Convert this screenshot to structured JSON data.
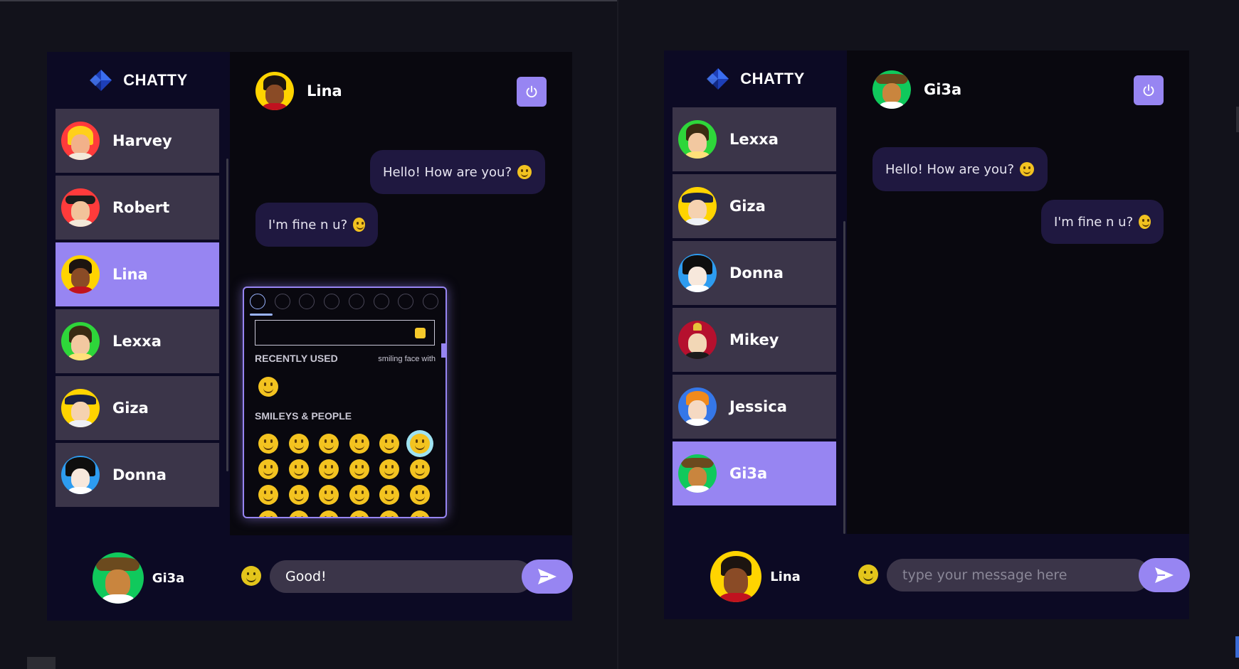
{
  "left": {
    "app_name": "CHATTY",
    "contacts": [
      {
        "name": "Harvey",
        "avatar": "harvey-avatar"
      },
      {
        "name": "Robert",
        "avatar": "robert-avatar"
      },
      {
        "name": "Lina",
        "avatar": "lina-avatar",
        "active": true
      },
      {
        "name": "Lexxa",
        "avatar": "lexxa-avatar"
      },
      {
        "name": "Giza",
        "avatar": "giza-avatar"
      },
      {
        "name": "Donna",
        "avatar": "donna-avatar"
      }
    ],
    "current_user": {
      "name": "Gi3a"
    },
    "chat": {
      "partner": "Lina",
      "messages": [
        {
          "text": "Hello! How are you?",
          "emoji": "smiley"
        },
        {
          "text": "I'm fine n u?",
          "emoji": "wink"
        }
      ],
      "input_value": "Good!",
      "input_placeholder": "type your message here"
    },
    "emoji_picker": {
      "recently_used_label": "RECENTLY USED",
      "hint": "smiling face with",
      "smileys_label": "SMILEYS & PEOPLE",
      "category_icons": [
        "people-icon",
        "face-icon",
        "animal-icon",
        "food-icon",
        "ball-icon",
        "clock-icon",
        "heart-icon",
        "globe-icon"
      ]
    }
  },
  "right": {
    "app_name": "CHATTY",
    "contacts": [
      {
        "name": "Lexxa",
        "avatar": "lexxa-avatar"
      },
      {
        "name": "Giza",
        "avatar": "giza-avatar"
      },
      {
        "name": "Donna",
        "avatar": "donna-avatar"
      },
      {
        "name": "Mikey",
        "avatar": "mikey-avatar"
      },
      {
        "name": "Jessica",
        "avatar": "jessica-avatar"
      },
      {
        "name": "Gi3a",
        "avatar": "gi3a-avatar",
        "active": true
      }
    ],
    "current_user": {
      "name": "Lina"
    },
    "chat": {
      "partner": "Gi3a",
      "messages": [
        {
          "text": "Hello! How are you?",
          "emoji": "smiley"
        },
        {
          "text": "I'm fine n u?",
          "emoji": "wink"
        }
      ],
      "input_value": "",
      "input_placeholder": "type your message here"
    }
  },
  "colors": {
    "accent": "#9785f2",
    "sidebar_bg": "#0c0a24",
    "chat_bg": "#09080f",
    "card_bg": "#3b3549",
    "bubble_bg": "#1f1840",
    "page_bg": "#12121b"
  }
}
